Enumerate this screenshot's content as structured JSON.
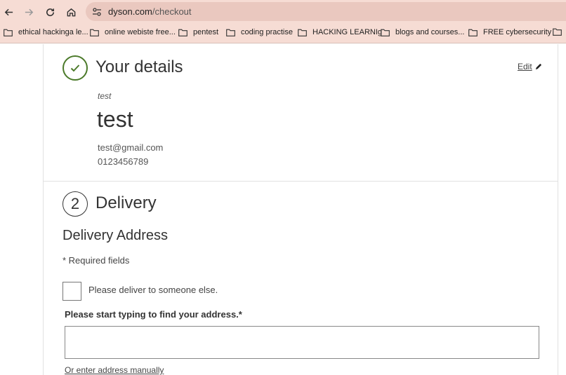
{
  "browser": {
    "url_host": "dyson.com",
    "url_path": "/checkout",
    "bookmarks": [
      "ethical hackinga le...",
      "online webiste free...",
      "pentest",
      "coding practise",
      "HACKING LEARNIg",
      "blogs and courses...",
      "FREE cybersecurity"
    ]
  },
  "details": {
    "title": "Your details",
    "edit_label": "Edit",
    "first_name": "test",
    "last_name": "test",
    "email": "test@gmail.com",
    "phone": "0123456789"
  },
  "delivery": {
    "step_number": "2",
    "title": "Delivery",
    "subheading": "Delivery Address",
    "required_note": "* Required fields",
    "deliver_someone_else_label": "Please deliver to someone else.",
    "deliver_someone_else_checked": false,
    "address_label": "Please start typing to find your address.*",
    "address_value": "",
    "manual_link": "Or enter address manually"
  },
  "colors": {
    "chrome_bg": "#f6dcd4",
    "omnibox_bg": "#eac8bf",
    "check_green": "#4b7a2a"
  }
}
